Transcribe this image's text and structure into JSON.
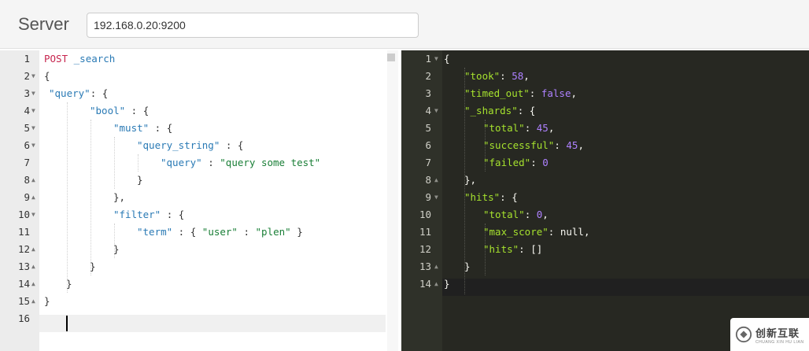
{
  "header": {
    "server_label": "Server",
    "server_value": "192.168.0.20:9200"
  },
  "request_editor": {
    "lines": [
      {
        "num": "1",
        "fold": ""
      },
      {
        "num": "2",
        "fold": "▼"
      },
      {
        "num": "3",
        "fold": "▼"
      },
      {
        "num": "4",
        "fold": "▼"
      },
      {
        "num": "5",
        "fold": "▼"
      },
      {
        "num": "6",
        "fold": "▼"
      },
      {
        "num": "7",
        "fold": ""
      },
      {
        "num": "8",
        "fold": "▲"
      },
      {
        "num": "9",
        "fold": "▲"
      },
      {
        "num": "10",
        "fold": "▼"
      },
      {
        "num": "11",
        "fold": ""
      },
      {
        "num": "12",
        "fold": "▲"
      },
      {
        "num": "13",
        "fold": "▲"
      },
      {
        "num": "14",
        "fold": "▲"
      },
      {
        "num": "15",
        "fold": "▲"
      },
      {
        "num": "16",
        "fold": ""
      }
    ],
    "method": "POST",
    "path": "_search",
    "tokens": {
      "l2": "{",
      "l3_key": "\"query\"",
      "l3_rest": ": {",
      "l4_key": "\"bool\"",
      "l4_rest": " : {",
      "l5_key": "\"must\"",
      "l5_rest": " : {",
      "l6_key": "\"query_string\"",
      "l6_rest": " : {",
      "l7_key": "\"query\"",
      "l7_mid": " : ",
      "l7_val": "\"query some test\"",
      "l8": "}",
      "l9": "},",
      "l10_key": "\"filter\"",
      "l10_rest": " : {",
      "l11_key": "\"term\"",
      "l11_mid1": " : { ",
      "l11_key2": "\"user\"",
      "l11_mid2": " : ",
      "l11_val": "\"plen\"",
      "l11_end": " }",
      "l12": "}",
      "l13": "}",
      "l14": "}",
      "l15": "}"
    }
  },
  "response_viewer": {
    "lines": [
      {
        "num": "1",
        "fold": "▼"
      },
      {
        "num": "2",
        "fold": ""
      },
      {
        "num": "3",
        "fold": ""
      },
      {
        "num": "4",
        "fold": "▼"
      },
      {
        "num": "5",
        "fold": ""
      },
      {
        "num": "6",
        "fold": ""
      },
      {
        "num": "7",
        "fold": ""
      },
      {
        "num": "8",
        "fold": "▲"
      },
      {
        "num": "9",
        "fold": "▼"
      },
      {
        "num": "10",
        "fold": ""
      },
      {
        "num": "11",
        "fold": ""
      },
      {
        "num": "12",
        "fold": ""
      },
      {
        "num": "13",
        "fold": "▲"
      },
      {
        "num": "14",
        "fold": "▲"
      }
    ],
    "tokens": {
      "r1": "{",
      "r2_key": "\"took\"",
      "r2_val": "58",
      "r3_key": "\"timed_out\"",
      "r3_val": "false",
      "r4_key": "\"_shards\"",
      "r4_rest": ": {",
      "r5_key": "\"total\"",
      "r5_val": "45",
      "r6_key": "\"successful\"",
      "r6_val": "45",
      "r7_key": "\"failed\"",
      "r7_val": "0",
      "r8": "},",
      "r9_key": "\"hits\"",
      "r9_rest": ": {",
      "r10_key": "\"total\"",
      "r10_val": "0",
      "r11_key": "\"max_score\"",
      "r11_val": "null",
      "r12_key": "\"hits\"",
      "r12_val": "[]",
      "r13": "}",
      "r14": "}"
    }
  },
  "watermark": {
    "cn_text": "创新互联",
    "en_text": "CHUANG XIN HU LIAN"
  },
  "colors": {
    "method": "#c7254e",
    "json_key_light": "#2a7ab5",
    "json_string_light": "#1a7f37",
    "json_key_dark": "#a6e22e",
    "json_number_dark": "#ae81ff",
    "dark_background": "#272822"
  }
}
